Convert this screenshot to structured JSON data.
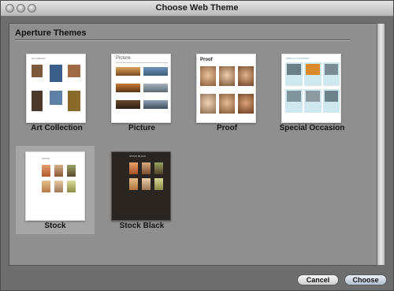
{
  "window": {
    "title": "Choose Web Theme"
  },
  "section": {
    "title": "Aperture Themes"
  },
  "themes": [
    {
      "label": "Art Collection",
      "selected": false,
      "style": "light",
      "heading": "Art Collection"
    },
    {
      "label": "Picture",
      "selected": false,
      "style": "light",
      "heading": "Picture"
    },
    {
      "label": "Proof",
      "selected": false,
      "style": "light",
      "heading": "Proof"
    },
    {
      "label": "Special Occasion",
      "selected": false,
      "style": "light",
      "heading": "SPECIAL OCCASION"
    },
    {
      "label": "Stock",
      "selected": true,
      "style": "light",
      "heading": "STOCK"
    },
    {
      "label": "Stock Black",
      "selected": false,
      "style": "dark",
      "heading": "STOCK BLACK"
    }
  ],
  "buttons": {
    "cancel": "Cancel",
    "choose": "Choose"
  },
  "colors": {
    "window_bg": "#6e6e6e",
    "content_bg": "#8f8f8f",
    "selection_bg": "#a6a6a6",
    "dark_theme_bg": "#2b2522",
    "special_occasion_accent": "#8fc9d6"
  }
}
